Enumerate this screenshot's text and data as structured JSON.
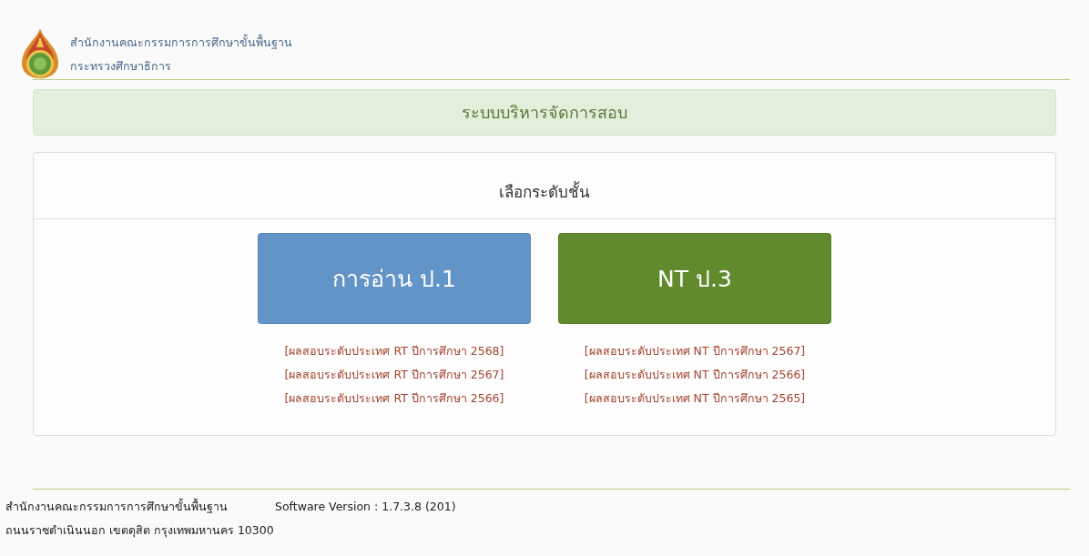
{
  "header": {
    "org_name": "สำนักงานคณะกรรมการการศึกษาขั้นพื้นฐาน",
    "ministry": "กระทรวงศึกษาธิการ"
  },
  "banner": {
    "title": "ระบบบริหารจัดการสอบ"
  },
  "panel": {
    "heading": "เลือกระดับชั้น",
    "options": [
      {
        "label": "การอ่าน ป.1",
        "color": "#6394c7",
        "links": [
          "[ผลสอบระดับประเทศ RT ปีการศึกษา 2568]",
          "[ผลสอบระดับประเทศ RT ปีการศึกษา 2567]",
          "[ผลสอบระดับประเทศ RT ปีการศึกษา 2566]"
        ]
      },
      {
        "label": "NT ป.3",
        "color": "#618a2c",
        "links": [
          "[ผลสอบระดับประเทศ NT ปีการศึกษา 2567]",
          "[ผลสอบระดับประเทศ NT ปีการศึกษา 2566]",
          "[ผลสอบระดับประเทศ NT ปีการศึกษา 2565]"
        ]
      }
    ]
  },
  "footer": {
    "org_name": "สำนักงานคณะกรรมการการศึกษาขั้นพื้นฐาน",
    "version": "Software Version : 1.7.3.8 (201)",
    "address": "ถนนราชดำเนินนอก เขตดุสิต กรุงเทพมหานคร 10300"
  }
}
